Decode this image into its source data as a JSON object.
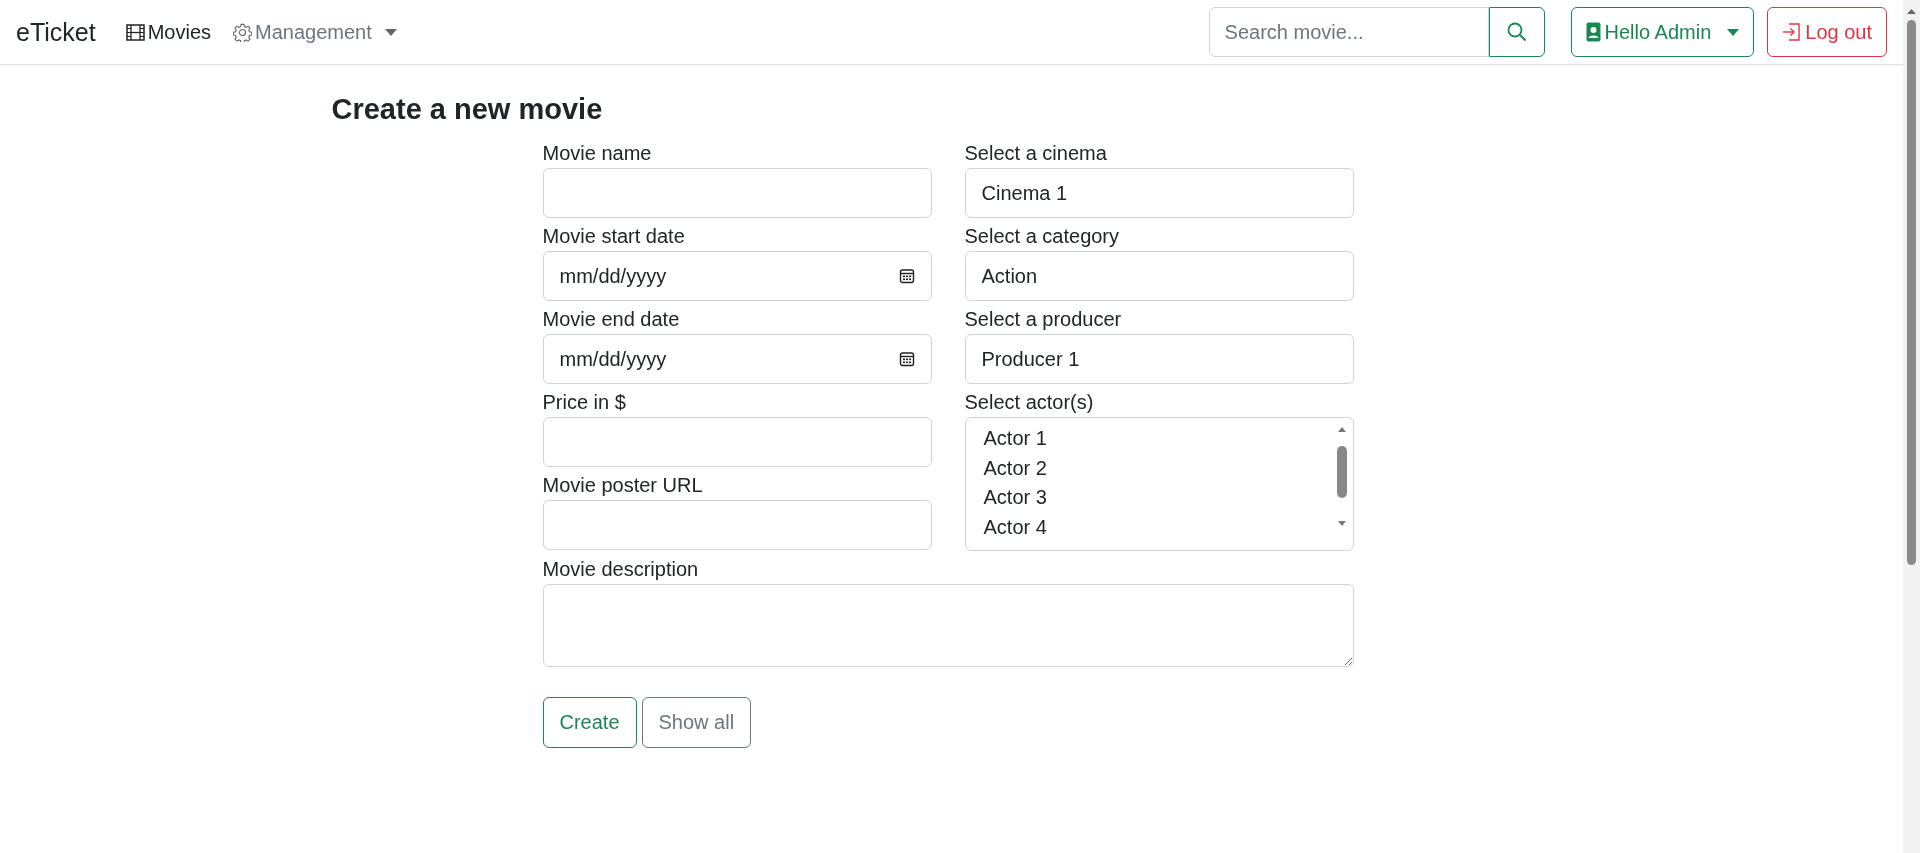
{
  "navbar": {
    "brand": "eTicket",
    "links": [
      {
        "label": "Movies",
        "kind": "link",
        "selected": true
      },
      {
        "label": "Management",
        "kind": "dropdown",
        "selected": false
      }
    ],
    "search": {
      "placeholder": "Search movie..."
    },
    "user_menu": {
      "label": "Hello Admin"
    },
    "logout": {
      "label": "Log out"
    }
  },
  "page": {
    "title": "Create a new movie"
  },
  "form": {
    "left_fields": [
      {
        "label": "Movie name",
        "kind": "text"
      },
      {
        "label": "Movie start date",
        "kind": "date",
        "placeholder": "mm/dd/yyyy"
      },
      {
        "label": "Movie end date",
        "kind": "date",
        "placeholder": "mm/dd/yyyy"
      },
      {
        "label": "Price in $",
        "kind": "text"
      },
      {
        "label": "Movie poster URL",
        "kind": "text"
      }
    ],
    "right_fields": [
      {
        "label": "Select a cinema",
        "kind": "select",
        "value": "Cinema 1"
      },
      {
        "label": "Select a category",
        "kind": "select",
        "value": "Action"
      },
      {
        "label": "Select a producer",
        "kind": "select",
        "value": "Producer 1"
      },
      {
        "label": "Select actor(s)",
        "kind": "multiselect",
        "options": [
          "Actor 1",
          "Actor 2",
          "Actor 3",
          "Actor 4"
        ]
      }
    ],
    "description": {
      "label": "Movie description",
      "kind": "textarea"
    },
    "buttons": [
      {
        "label": "Create",
        "kind": "primary"
      },
      {
        "label": "Show all",
        "kind": "secondary"
      }
    ]
  }
}
